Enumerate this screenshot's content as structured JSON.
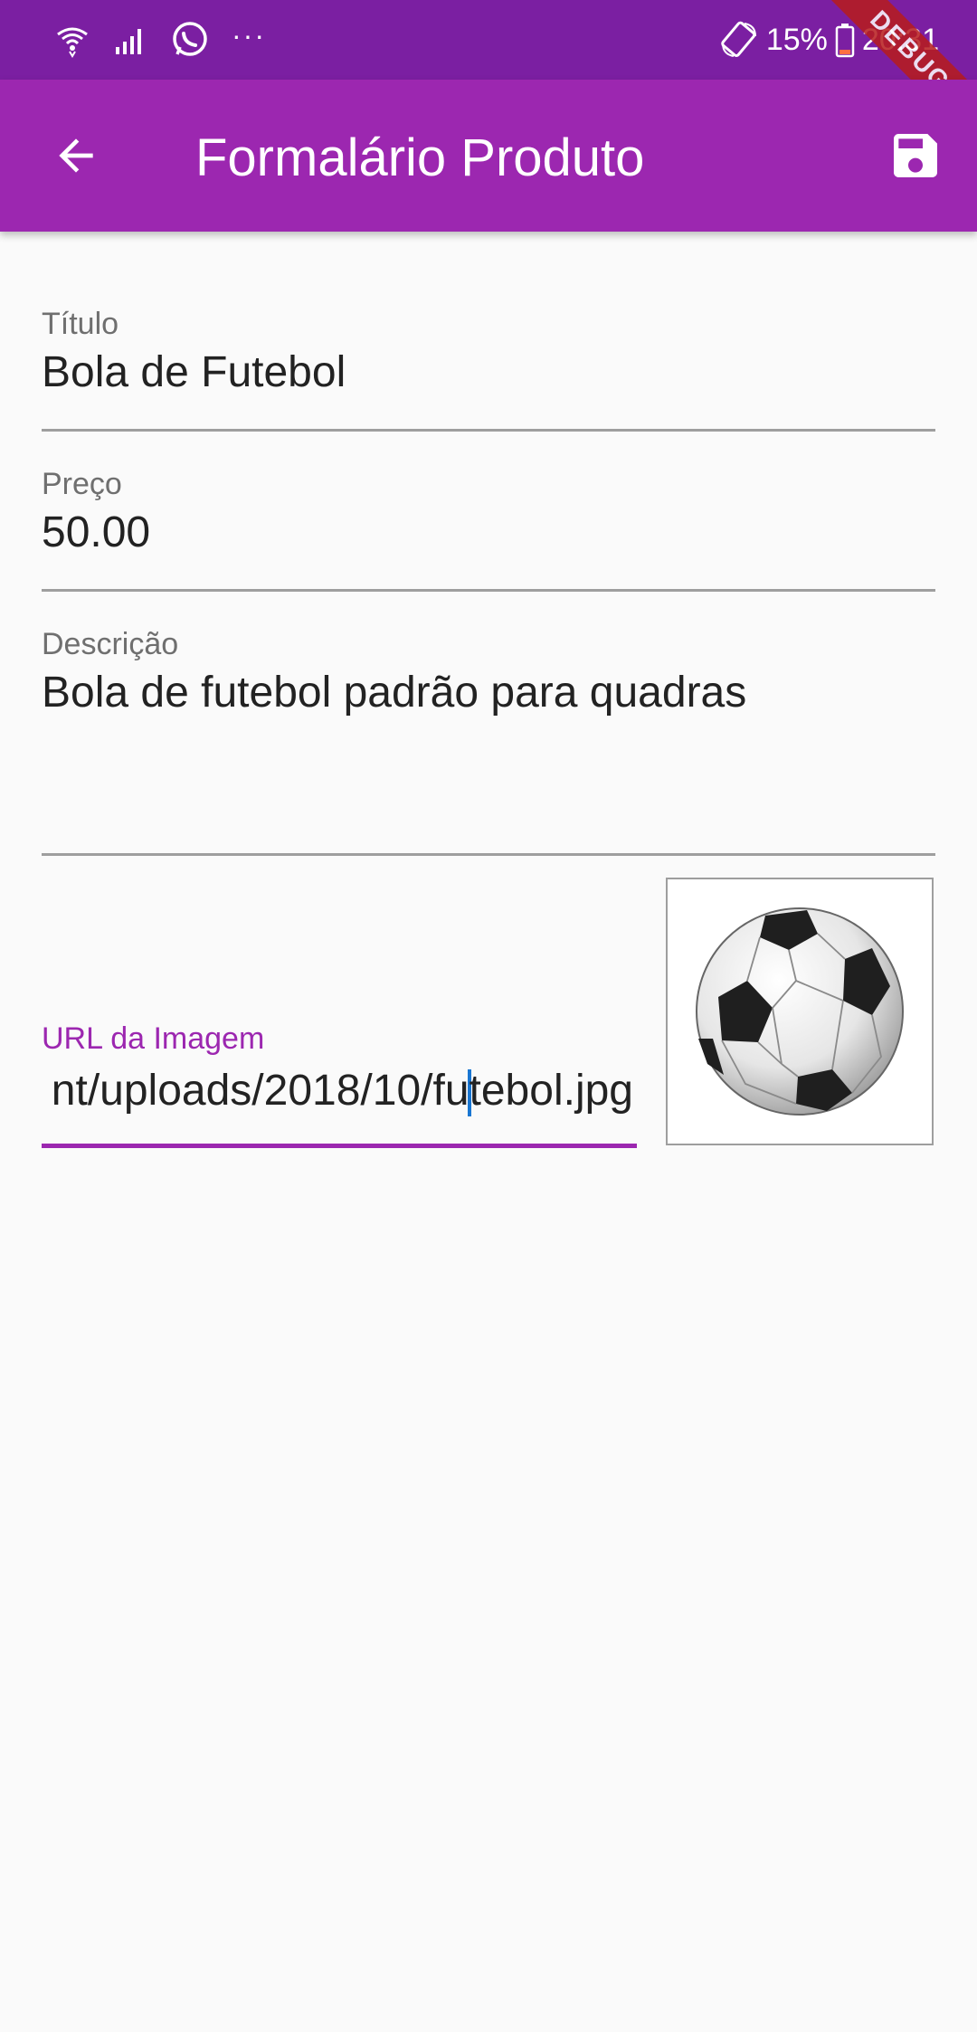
{
  "status_bar": {
    "icons": [
      "wifi-icon",
      "signal-icon",
      "whatsapp-icon"
    ],
    "dots": "···",
    "battery_percent": "15%",
    "time": "20:31"
  },
  "debug_banner": "DEBUG",
  "app_bar": {
    "title": "Formalário Produto",
    "back_icon": "arrow-back-icon",
    "save_icon": "save-icon"
  },
  "form": {
    "title_field": {
      "label": "Título",
      "value": "Bola de Futebol"
    },
    "price_field": {
      "label": "Preço",
      "value": "50.00"
    },
    "description_field": {
      "label": "Descrição",
      "value": "Bola de futebol padrão para quadras"
    },
    "image_url_field": {
      "label": "URL da Imagem",
      "value_visible_part1": "nt/uploads/2018/10/fu",
      "value_visible_part2": "tebol.jpg"
    }
  },
  "image_preview": "soccer-ball-image",
  "colors": {
    "primary": "#9c27b0",
    "primary_dark": "#7b1fa2",
    "background": "#fafafa"
  }
}
